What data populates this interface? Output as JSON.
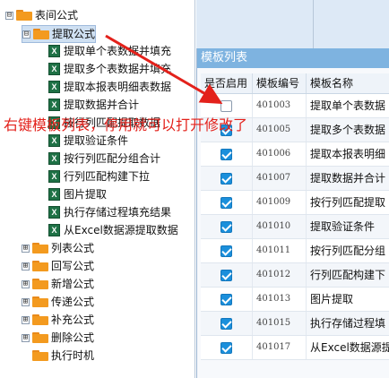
{
  "tree": {
    "root": {
      "toggle": "⊟",
      "label": "表间公式"
    },
    "group_open": {
      "toggle": "⊟",
      "label": "提取公式"
    },
    "items": [
      "提取单个表数据并填充",
      "提取多个表数据并填充",
      "提取本报表明细表数据",
      "提取数据并合计",
      "按行列匹配提取数据",
      "提取验证条件",
      "按行列匹配分组合计",
      "行列匹配构建下拉",
      "图片提取",
      "执行存储过程填充结果",
      "从Excel数据源提取数据"
    ],
    "groups": [
      {
        "toggle": "⊞",
        "label": "列表公式"
      },
      {
        "toggle": "⊞",
        "label": "回写公式"
      },
      {
        "toggle": "⊞",
        "label": "新增公式"
      },
      {
        "toggle": "⊞",
        "label": "传递公式"
      },
      {
        "toggle": "⊞",
        "label": "补充公式"
      },
      {
        "toggle": "⊞",
        "label": "删除公式"
      },
      {
        "toggle": "",
        "label": "执行时机"
      }
    ],
    "xls_icon_letter": "X"
  },
  "panel": {
    "title": "模板列表",
    "columns": [
      "是否启用",
      "模板编号",
      "模板名称"
    ],
    "rows": [
      {
        "enabled": false,
        "code": "401003",
        "name": "提取单个表数据"
      },
      {
        "enabled": true,
        "code": "401005",
        "name": "提取多个表数据"
      },
      {
        "enabled": true,
        "code": "401006",
        "name": "提取本报表明细"
      },
      {
        "enabled": true,
        "code": "401007",
        "name": "提取数据并合计"
      },
      {
        "enabled": true,
        "code": "401009",
        "name": "按行列匹配提取"
      },
      {
        "enabled": true,
        "code": "401010",
        "name": "提取验证条件"
      },
      {
        "enabled": true,
        "code": "401011",
        "name": "按行列匹配分组"
      },
      {
        "enabled": true,
        "code": "401012",
        "name": "行列匹配构建下"
      },
      {
        "enabled": true,
        "code": "401013",
        "name": "图片提取"
      },
      {
        "enabled": true,
        "code": "401015",
        "name": "执行存储过程填"
      },
      {
        "enabled": true,
        "code": "401017",
        "name": "从Excel数据源提"
      }
    ]
  },
  "annotation": {
    "text": "右键模板列表，停用就可以打开修改了",
    "color": "#e3211b"
  },
  "colors": {
    "accent": "#7eb3e0",
    "check": "#1b8fdb",
    "folder": "#f39a1f",
    "excel": "#1e7145"
  }
}
